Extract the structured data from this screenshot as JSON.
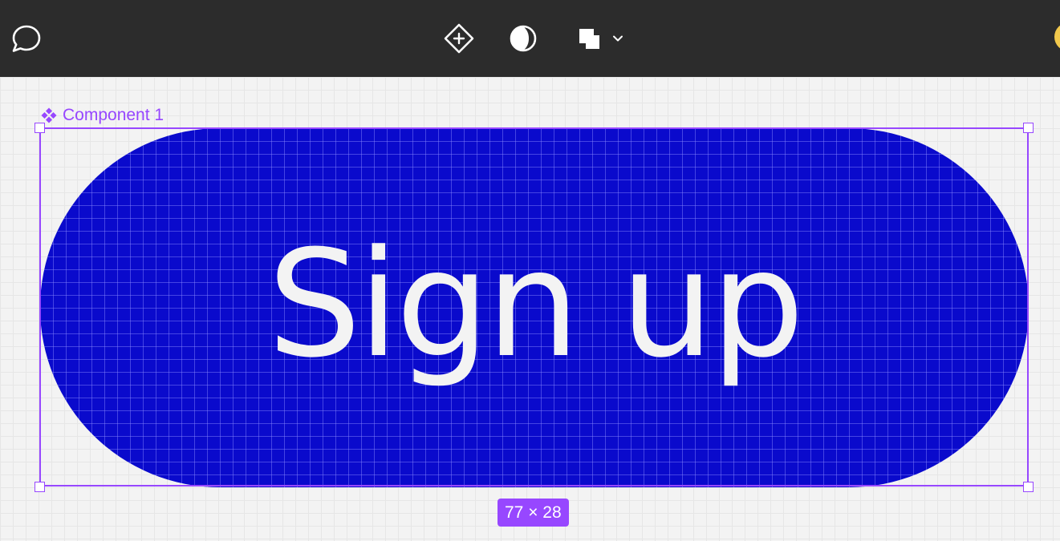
{
  "toolbar": {
    "buttons": [
      {
        "name": "comment-button",
        "icon": "comment-bubble-icon"
      },
      {
        "name": "create-component-button",
        "icon": "component-add-icon"
      },
      {
        "name": "theme-toggle-button",
        "icon": "contrast-icon"
      },
      {
        "name": "boolean-shapes-button",
        "icon": "union-shapes-icon"
      },
      {
        "name": "boolean-shapes-dropdown",
        "icon": "chevron-down-icon"
      }
    ],
    "avatar_color": "#f2c94c"
  },
  "canvas": {
    "background": "#f3f3f3",
    "component": {
      "label": "Component 1",
      "label_icon": "component-diamonds-icon",
      "button_text": "Sign up",
      "fill_color": "#0a0acc",
      "text_color": "#f3f3f3"
    },
    "selection": {
      "color": "#9747ff",
      "dimensions": "77 × 28"
    }
  }
}
